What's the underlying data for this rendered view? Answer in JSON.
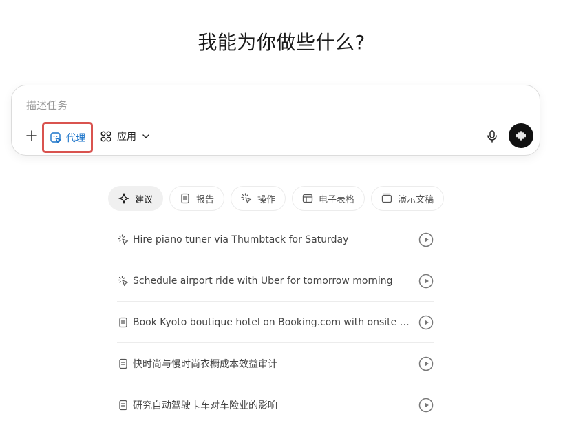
{
  "heading": "我能为你做些什么?",
  "composer": {
    "placeholder": "描述任务",
    "agent_label": "代理",
    "apps_label": "应用"
  },
  "tabs": [
    {
      "label": "建议",
      "icon": "sparkle-icon",
      "active": true
    },
    {
      "label": "报告",
      "icon": "document-icon",
      "active": false
    },
    {
      "label": "操作",
      "icon": "cursor-click-icon",
      "active": false
    },
    {
      "label": "电子表格",
      "icon": "table-icon",
      "active": false
    },
    {
      "label": "演示文稿",
      "icon": "slides-icon",
      "active": false
    }
  ],
  "suggestions": [
    {
      "text": "Hire piano tuner via Thumbtack for Saturday",
      "icon": "cursor-click-icon"
    },
    {
      "text": "Schedule airport ride with Uber for tomorrow morning",
      "icon": "cursor-click-icon"
    },
    {
      "text": "Book Kyoto boutique hotel on Booking.com with onsite onsen",
      "icon": "document-icon"
    },
    {
      "text": "快时尚与慢时尚衣橱成本效益审计",
      "icon": "document-icon"
    },
    {
      "text": "研究自动驾驶卡车对车险业的影响",
      "icon": "document-icon"
    }
  ],
  "colors": {
    "agent_accent": "#1a73c9",
    "highlight_border": "#d9534f",
    "voice_button_bg": "#111111"
  }
}
